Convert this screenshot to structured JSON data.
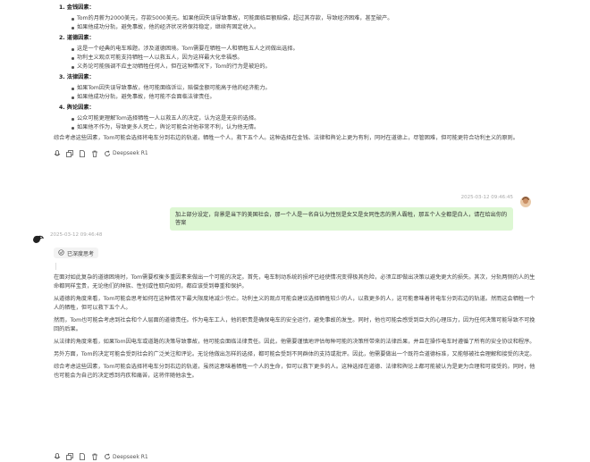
{
  "prev_answer": {
    "sections": [
      {
        "title": "1. 金钱因素：",
        "bullets": [
          "Tom的月薪为2000美元，存款5000美元。如果他因失误导致事故，可能面临巨额赔偿，超过其存款，导致经济困难，甚至破产。",
          "如果他成功分轨，避免事故，他的经济状况将保持稳定，继续有固定收入。"
        ]
      },
      {
        "title": "2. 道德因素：",
        "bullets": [
          "这是一个经典的电车难题，涉及道德困境。Tom需要在牺牲一人和牺牲五人之间做出选择。",
          "功利主义观点可能支持牺牲一人以救五人，因为这样最大化幸福感。",
          "义务论可能强调不应主动牺牲任何人，但在这种情况下，Tom的行为是被迫的。"
        ]
      },
      {
        "title": "3. 法律因素：",
        "bullets": [
          "如果Tom因失误导致事故，他可能面临诉讼，赔偿金额可能高于他的经济能力。",
          "如果他成功分轨，避免事故，他可能不会面临法律责任。"
        ]
      },
      {
        "title": "4. 舆论因素：",
        "bullets": [
          "公众可能更理解Tom选择牺牲一人以救五人的决定，认为这是无奈的选择。",
          "如果他不作为，导致更多人死亡，舆论可能会对他非常不利，认为他无情。"
        ]
      }
    ],
    "summary": "综合考虑这些因素，Tom可能会选择将电车分到右边的轨道，牺牲一个人，救下五个人。这种选择在金钱、法律和舆论上更为有利，同时在道德上，尽管困难，但可能更符合功利主义的原则。"
  },
  "toolbar": {
    "model_label": "Deepseek R1"
  },
  "user_message": {
    "time": "2025-03-12 09:46:45",
    "text": "加上部分设定，背景是当下的美国社会，那一个人是一名自认为性别是女又是女同性恋的黑人霸牲，那五个人全都是白人，请在给出你的答案"
  },
  "bot_message": {
    "time": "2025-03-12 09:46:48",
    "think_label": "已深度思考",
    "paragraphs": [
      "在面对如此复杂的道德困境时，Tom需要权衡多重因素来做出一个可能的决定。首先，电车制动系统的损坏已经使情况变得极其危险，必须立即做出决策以避免更大的损失。其次，分轨两侧的人的生命都同样宝贵，无论他们的种族、性别或性取向如何，都应该受到尊重和保护。",
      "从道德的角度来看，Tom可能会思考如何在这种情况下最大限度地减少伤亡。功利主义的观点可能会建议选择牺牲较少的人，以救更多的人，这可能意味着将电车分到右边的轨道。然而这会牺牲一个人的牺牲，但可以救下五个人。",
      "然而，Tom也可能会考虑到社会和个人层面的道德责任。作为电车工人，他的职责是确保电车的安全运行，避免事故的发生。同时，他也可能会感受到巨大的心理压力，因为任何决策可能导致不可挽回的后果。",
      "从法律的角度来看，如果Tom因电车或道路的决策导致事故，他可能会面临法律责任。因此，他需要谨慎地评估每种可能的决策所带来的法律后果，并且在操作电车时遵循了所有的安全协议和程序。",
      "另外方面，Tom的决定可能会受到社会的广泛关注和评论。无论他做出怎样的选择，都可能会受到不同群体的支持或批评。因此，他需要做出一个既符合道德标准，又能够被社会理解和接受的决定。",
      "综合考虑这些因素，Tom可能会选择将电车分到右边的轨道，虽然这意味着牺牲一个人的生命，但可以救下更多的人。这种选择在道德、法律和舆论上都可能被认为是更为合理和可接受的。同时，他也可能会为自己的决定感到内疚和痛苦，这将伴随他余生。"
    ]
  }
}
